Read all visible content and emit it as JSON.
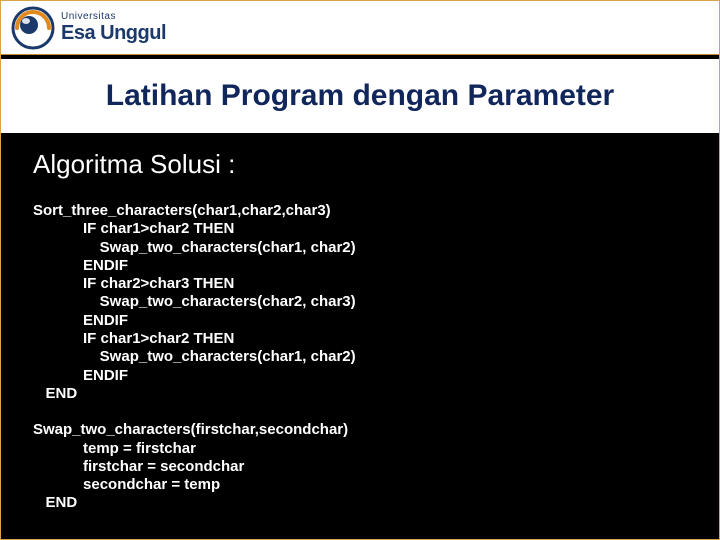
{
  "logo": {
    "university_label": "Universitas",
    "brand_name": "Esa Unggul"
  },
  "title": "Latihan Program dengan Parameter",
  "subtitle": "Algoritma Solusi :",
  "code_block_1": "Sort_three_characters(char1,char2,char3)\n            IF char1>char2 THEN\n                Swap_two_characters(char1, char2)\n            ENDIF\n            IF char2>char3 THEN\n                Swap_two_characters(char2, char3)\n            ENDIF\n            IF char1>char2 THEN\n                Swap_two_characters(char1, char2)\n            ENDIF\n   END",
  "code_block_2": "Swap_two_characters(firstchar,secondchar)\n            temp = firstchar\n            firstchar = secondchar\n            secondchar = temp\n   END"
}
